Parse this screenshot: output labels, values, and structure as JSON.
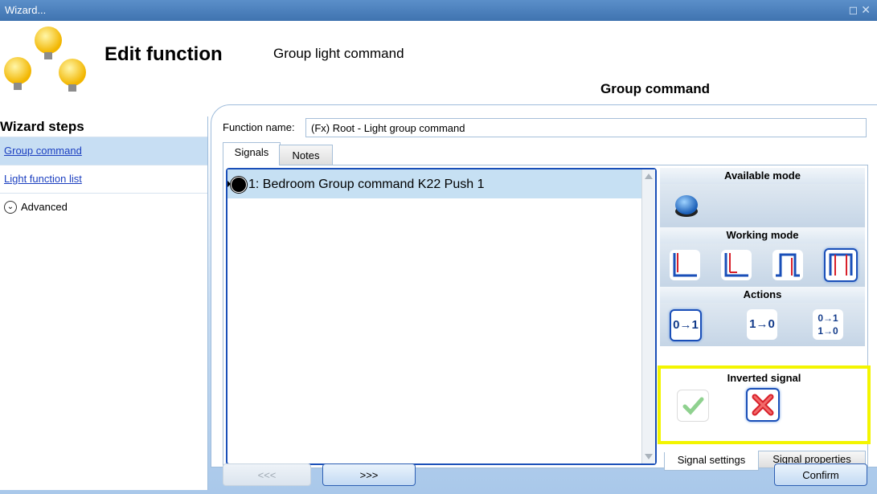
{
  "window": {
    "title": "Wizard...",
    "controls": "◻ ✕"
  },
  "header": {
    "title": "Edit function",
    "subtitle": "Group light command",
    "active_step_tab": "Group command"
  },
  "sidebar": {
    "heading": "Wizard steps",
    "items": [
      {
        "label": "Group command",
        "selected": true
      },
      {
        "label": "Light function list",
        "selected": false
      }
    ],
    "advanced_label": "Advanced"
  },
  "form": {
    "function_name_label": "Function name:",
    "function_name_value": "(Fx) Root - Light group command"
  },
  "tabs": {
    "signals": "Signals",
    "notes": "Notes"
  },
  "signals": [
    {
      "label": "1: Bedroom Group command K22 Push 1"
    }
  ],
  "settings": {
    "available_mode_title": "Available mode",
    "working_mode_title": "Working mode",
    "actions_title": "Actions",
    "action_labels": [
      "0→1",
      "1→0",
      "0→1 1→0"
    ],
    "inverted_signal_title": "Inverted signal",
    "selected_working_mode": 4,
    "selected_action": 1,
    "inverted_selected": "no"
  },
  "bottom_tabs": {
    "signal_settings": "Signal settings",
    "signal_properties": "Signal properties"
  },
  "buttons": {
    "prev": "<<<",
    "next": ">>>",
    "confirm": "Confirm"
  },
  "colors": {
    "titlebar": "#3f73b0",
    "highlight_frame": "#f3f500",
    "link": "#1b3fc0",
    "selected_row": "#c6e0f3"
  }
}
